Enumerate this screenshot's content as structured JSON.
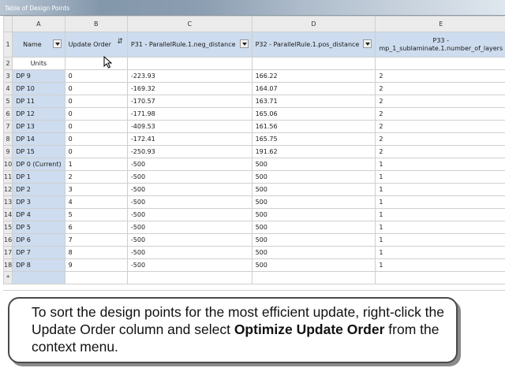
{
  "window": {
    "title": "Table of Design Points"
  },
  "columns": [
    "A",
    "B",
    "C",
    "D",
    "E"
  ],
  "headers": {
    "name": "Name",
    "update_order": "Update Order",
    "p31": "P31 - ParallelRule.1.neg_distance",
    "p32": "P32 - ParallelRule.1.pos_distance",
    "p33": "P33 - mp_1_sublaminate.1.number_of_layers"
  },
  "units_label": "Units",
  "rows": [
    {
      "num": "3",
      "name": "DP 9",
      "order": "0",
      "p31": "-223.93",
      "p32": "166.22",
      "p33": "2"
    },
    {
      "num": "4",
      "name": "DP 10",
      "order": "0",
      "p31": "-169.32",
      "p32": "164.07",
      "p33": "2"
    },
    {
      "num": "5",
      "name": "DP 11",
      "order": "0",
      "p31": "-170.57",
      "p32": "163.71",
      "p33": "2"
    },
    {
      "num": "6",
      "name": "DP 12",
      "order": "0",
      "p31": "-171.98",
      "p32": "165.06",
      "p33": "2"
    },
    {
      "num": "7",
      "name": "DP 13",
      "order": "0",
      "p31": "-409.53",
      "p32": "161.56",
      "p33": "2"
    },
    {
      "num": "8",
      "name": "DP 14",
      "order": "0",
      "p31": "-172.41",
      "p32": "165.75",
      "p33": "2"
    },
    {
      "num": "9",
      "name": "DP 15",
      "order": "0",
      "p31": "-250.93",
      "p32": "191.62",
      "p33": "2"
    },
    {
      "num": "10",
      "name": "DP 0 (Current)",
      "order": "1",
      "p31": "-500",
      "p32": "500",
      "p33": "1"
    },
    {
      "num": "11",
      "name": "DP 1",
      "order": "2",
      "p31": "-500",
      "p32": "500",
      "p33": "1"
    },
    {
      "num": "12",
      "name": "DP 2",
      "order": "3",
      "p31": "-500",
      "p32": "500",
      "p33": "1"
    },
    {
      "num": "13",
      "name": "DP 3",
      "order": "4",
      "p31": "-500",
      "p32": "500",
      "p33": "1"
    },
    {
      "num": "14",
      "name": "DP 4",
      "order": "5",
      "p31": "-500",
      "p32": "500",
      "p33": "1"
    },
    {
      "num": "15",
      "name": "DP 5",
      "order": "6",
      "p31": "-500",
      "p32": "500",
      "p33": "1"
    },
    {
      "num": "16",
      "name": "DP 6",
      "order": "7",
      "p31": "-500",
      "p32": "500",
      "p33": "1"
    },
    {
      "num": "17",
      "name": "DP 7",
      "order": "8",
      "p31": "-500",
      "p32": "500",
      "p33": "1"
    },
    {
      "num": "18",
      "name": "DP 8",
      "order": "9",
      "p31": "-500",
      "p32": "500",
      "p33": "1"
    }
  ],
  "new_row_marker": "*",
  "callout": {
    "text_before": "To sort the design points for the most efficient update, right-click the Update Order column and select ",
    "bold": "Optimize Update Order",
    "text_after": " from the context menu."
  }
}
